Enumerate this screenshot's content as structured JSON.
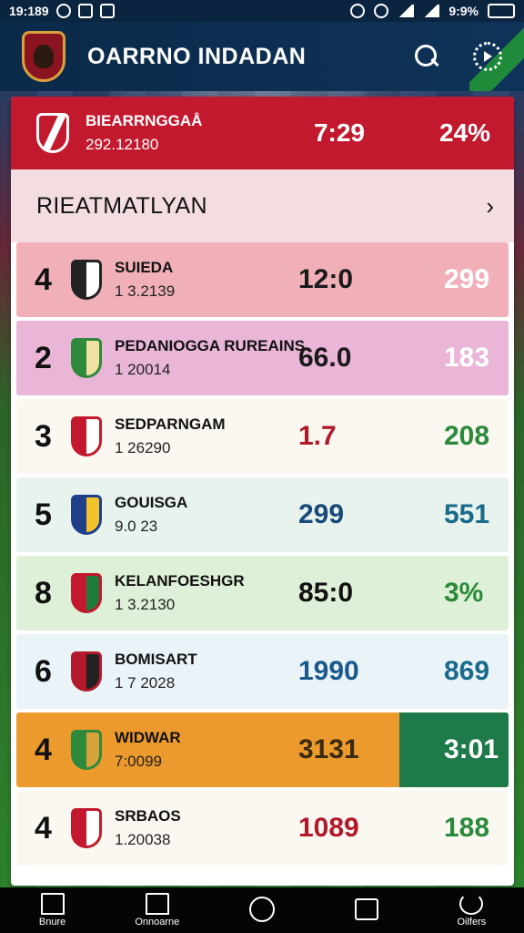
{
  "status_bar": {
    "time": "19:189",
    "battery": "9:9%"
  },
  "app": {
    "title": "OARRNO INDADAN"
  },
  "featured": {
    "name": "BIEARRNGGAÅ",
    "sub": "292.12180",
    "value1": "7:29",
    "value2": "24%"
  },
  "section": {
    "title": "RIEATMATLYAN"
  },
  "rows": [
    {
      "rank": "4",
      "name": "SUIEDA",
      "sub": "1 3.2139",
      "value1": "12:0",
      "value2": "299",
      "bg": "#f1b0b8",
      "val1_color": "#1a1a1a",
      "val2_color": "#ffffff",
      "crest": "#222222",
      "crest2": "#ffffff"
    },
    {
      "rank": "2",
      "name": "PEDANIOGGA RUREAINS",
      "sub": "1 20014",
      "value1": "66.0",
      "value2": "183",
      "bg": "#eab6d8",
      "val1_color": "#1a1a1a",
      "val2_color": "#ffffff",
      "crest": "#2e8a3a",
      "crest2": "#f1e0a0"
    },
    {
      "rank": "3",
      "name": "SEDPARNGAM",
      "sub": "1 26290",
      "value1": "1.7",
      "value2": "208",
      "bg": "#fbf7f1",
      "val1_color": "#b01a2a",
      "val2_color": "#2a8a3a",
      "crest": "#c2192e",
      "crest2": "#ffffff"
    },
    {
      "rank": "5",
      "name": "GOUISGA",
      "sub": "9.0 23",
      "value1": "299",
      "value2": "551",
      "bg": "#e8f3ee",
      "val1_color": "#1a4a7a",
      "val2_color": "#1a6a8a",
      "crest": "#1f3f8a",
      "crest2": "#f2c22a"
    },
    {
      "rank": "8",
      "name": "KELANFOESHGR",
      "sub": "1 3.2130",
      "value1": "85:0",
      "value2": "3%",
      "bg": "#dff0d8",
      "val1_color": "#111111",
      "val2_color": "#2a8a3a",
      "crest": "#c2192e",
      "crest2": "#1f7a3a"
    },
    {
      "rank": "6",
      "name": "BOMISART",
      "sub": "1 7 2028",
      "value1": "1990",
      "value2": "869",
      "bg": "#eaf3f8",
      "val1_color": "#1a5a8a",
      "val2_color": "#1a6a8a",
      "crest": "#b01a2a",
      "crest2": "#222222"
    },
    {
      "rank": "4",
      "name": "WIDWAR",
      "sub": "7:0099",
      "value1": "3131",
      "value2": "3:01",
      "bg": "#ec9a2e",
      "val1_color": "#3a2a10",
      "val2_color": "#ffffff",
      "crest": "#2e8a3a",
      "crest2": "#d8a23a",
      "accent": "#1f7a4a"
    },
    {
      "rank": "4",
      "name": "SRBAOS",
      "sub": "1.20038",
      "value1": "1089",
      "value2": "188",
      "bg": "#fbf7f1",
      "val1_color": "#b01a2a",
      "val2_color": "#2a8a3a",
      "crest": "#c2192e",
      "crest2": "#ffffff"
    }
  ],
  "nav": [
    {
      "label": "Bnure",
      "icon": "home-icon"
    },
    {
      "label": "Onnoarne",
      "icon": "stadium-icon"
    },
    {
      "label": "",
      "icon": "circle-icon"
    },
    {
      "label": "",
      "icon": "square-icon"
    },
    {
      "label": "Oilfers",
      "icon": "refresh-icon"
    }
  ]
}
